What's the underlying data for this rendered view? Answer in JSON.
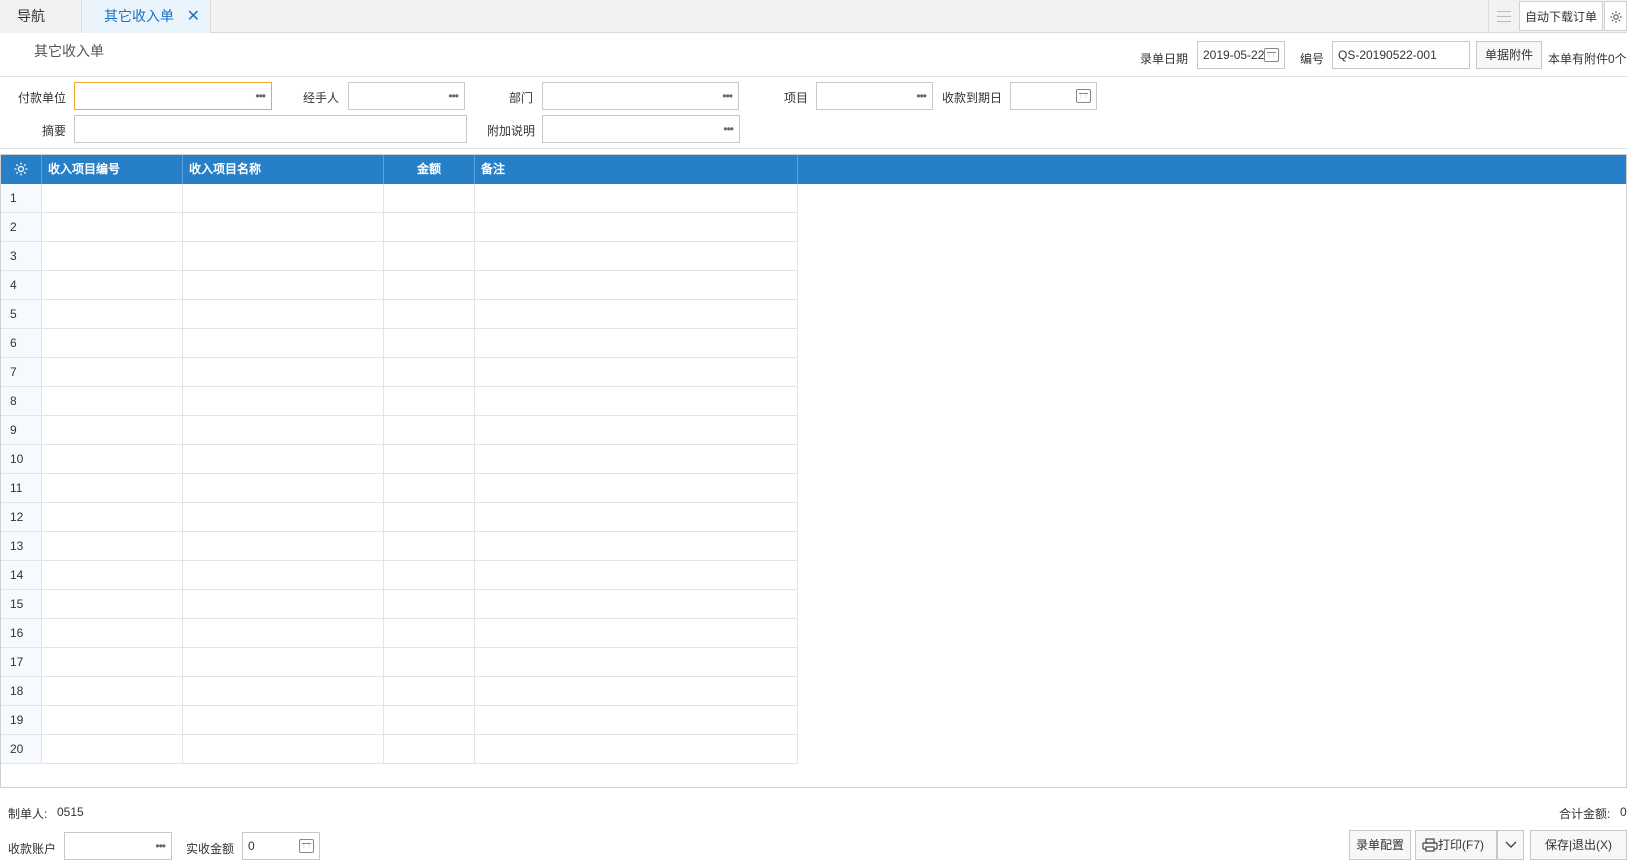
{
  "tabs": {
    "nav_label": "导航",
    "active_label": "其它收入单",
    "close_glyph": "✕",
    "auto_download_label": "自动下载订单"
  },
  "header": {
    "title": "其它收入单",
    "date_label": "录单日期",
    "date_value": "2019-05-22",
    "code_label": "编号",
    "code_value": "QS-20190522-001",
    "attach_button": "单据附件",
    "attach_info": "本单有附件0个"
  },
  "fields": {
    "payer_label": "付款单位",
    "handler_label": "经手人",
    "dept_label": "部门",
    "project_label": "项目",
    "due_label": "收款到期日",
    "summary_label": "摘要",
    "note_label": "附加说明"
  },
  "grid": {
    "columns": [
      "收入项目编号",
      "收入项目名称",
      "金额",
      "备注"
    ],
    "rows": [
      "1",
      "2",
      "3",
      "4",
      "5",
      "6",
      "7",
      "8",
      "9",
      "10",
      "11",
      "12",
      "13",
      "14",
      "15",
      "16",
      "17",
      "18",
      "19",
      "20"
    ]
  },
  "footer": {
    "maker_label": "制单人:",
    "maker_value": "0515",
    "total_label": "合计金额:",
    "total_value": "0",
    "account_label": "收款账户",
    "received_label": "实收金额",
    "received_value": "0",
    "config_button": "录单配置",
    "print_button": "打印(F7)",
    "save_button": "保存|退出(X)"
  },
  "colors": {
    "accent": "#2780c7",
    "tab_active_text": "#1a73c7",
    "focus_border": "#f0a830"
  }
}
